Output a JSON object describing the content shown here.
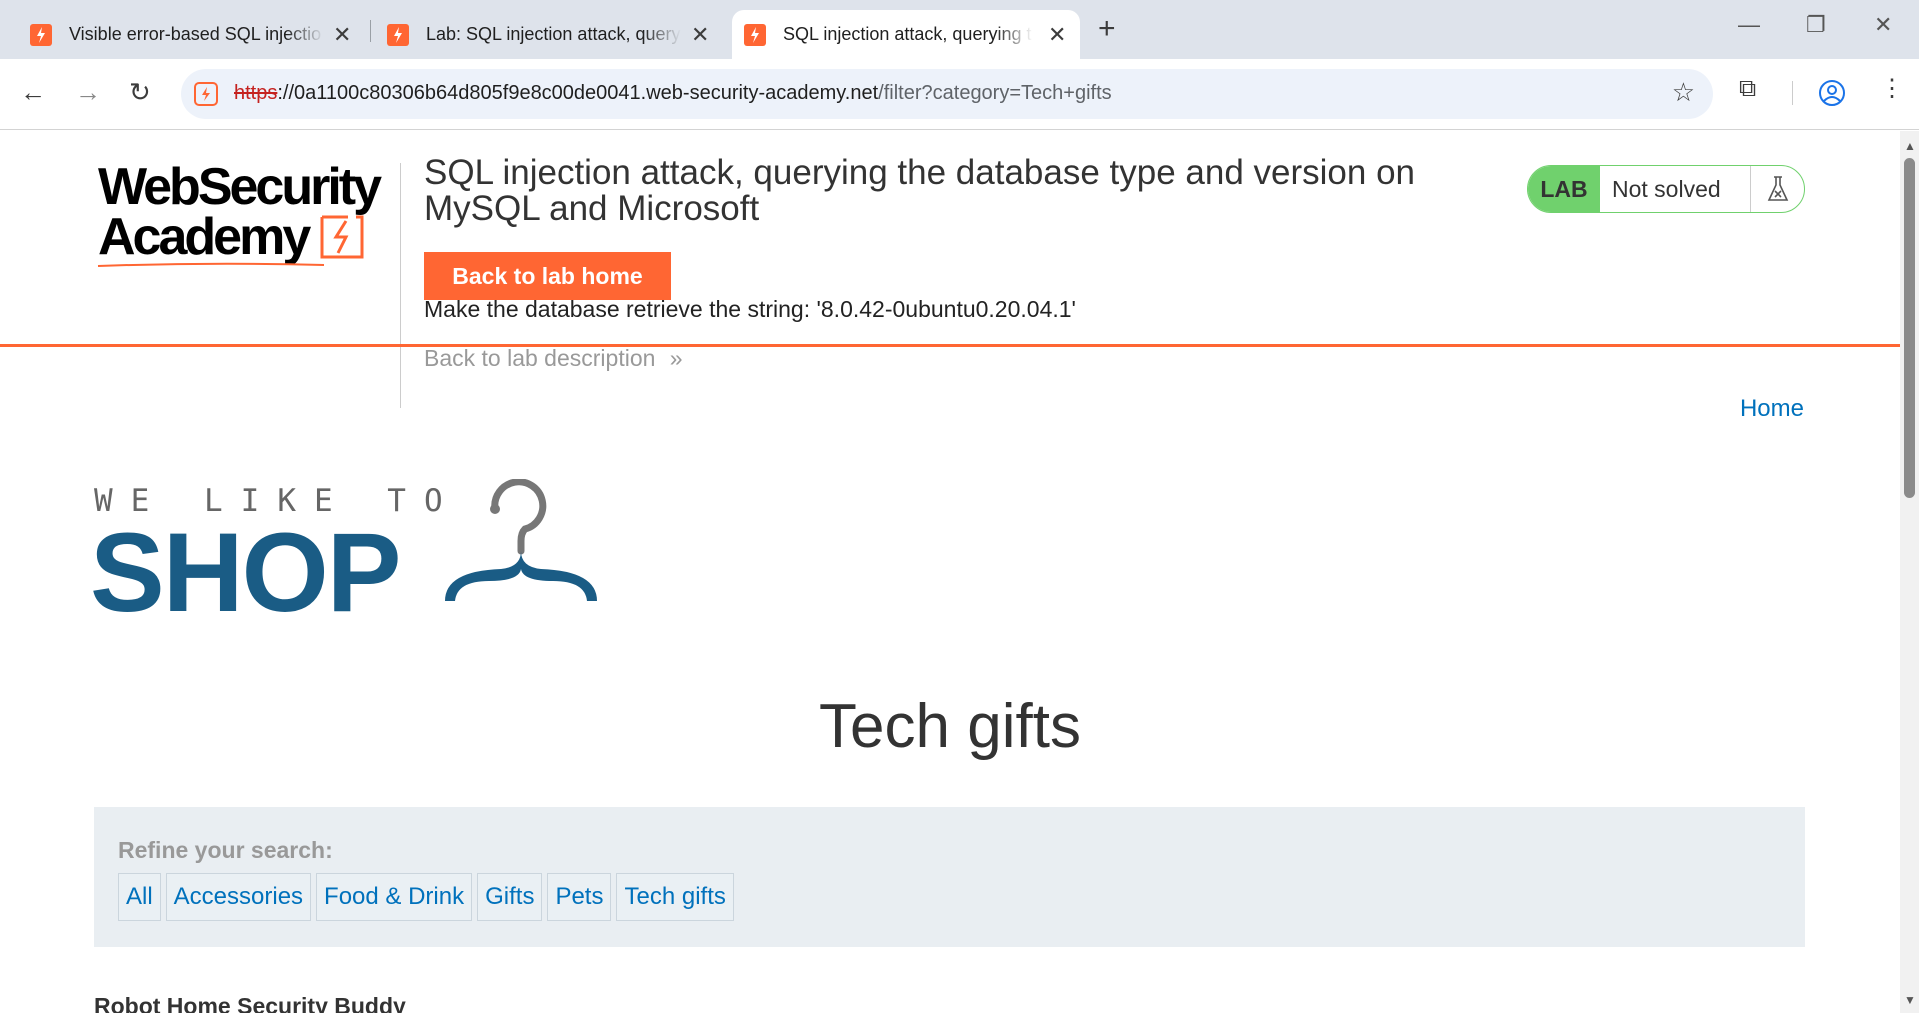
{
  "browser": {
    "tabs": [
      {
        "title": "Visible error-based SQL injectio",
        "active": false
      },
      {
        "title": "Lab: SQL injection attack, query",
        "active": false
      },
      {
        "title": "SQL injection attack, querying t",
        "active": true
      }
    ],
    "url_scheme": "https",
    "url_host": "://0a1100c80306b64d805f9e8c00de0041.web-security-academy.net",
    "url_path": "/filter?category=Tech+gifts"
  },
  "header": {
    "logo_line1": "WebSecurity",
    "logo_line2": "Academy",
    "lab_title": "SQL injection attack, querying the database type and version on MySQL and Microsoft",
    "back_to_lab_home": "Back to lab home",
    "goal_text": "Make the database retrieve the string: '8.0.42-0ubuntu0.20.04.1'",
    "back_to_description": "Back to lab description",
    "badge_label": "LAB",
    "badge_status": "Not solved"
  },
  "nav": {
    "home": "Home"
  },
  "shop_logo": {
    "tagline": "WE LIKE TO",
    "word": "SHOP"
  },
  "category": {
    "title": "Tech gifts"
  },
  "refine": {
    "label": "Refine your search:",
    "filters": [
      "All",
      "Accessories",
      "Food & Drink",
      "Gifts",
      "Pets",
      "Tech gifts"
    ]
  },
  "products": [
    {
      "name": "Robot Home Security Buddy"
    }
  ],
  "colors": {
    "accent": "#ff6633",
    "link": "#0071bc",
    "lab_green": "#70d16d",
    "shop_blue": "#1a5c85"
  }
}
